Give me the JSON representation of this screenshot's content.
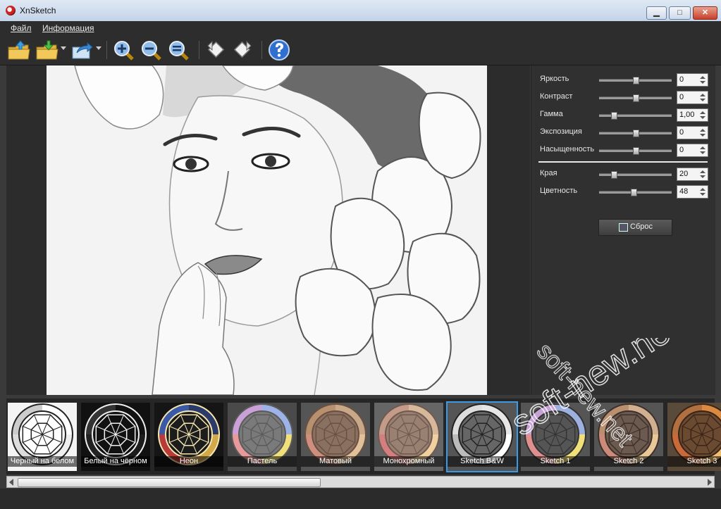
{
  "window": {
    "title": "XnSketch",
    "min_glyph": "▁",
    "max_glyph": "□",
    "close_glyph": "✕"
  },
  "menu": [
    {
      "label": "Файл"
    },
    {
      "label": "Информация"
    }
  ],
  "toolbar": {
    "buttons": [
      {
        "icon": "open-folder-icon"
      },
      {
        "icon": "save-folder-icon"
      },
      {
        "icon": "export-icon"
      },
      {
        "icon": "zoom-in-icon"
      },
      {
        "icon": "zoom-out-icon"
      },
      {
        "icon": "zoom-fit-icon"
      },
      {
        "icon": "rotate-left-icon"
      },
      {
        "icon": "rotate-right-icon"
      },
      {
        "icon": "help-icon"
      }
    ]
  },
  "adjustments": [
    {
      "label": "Яркость",
      "value": "0",
      "level": 0.5
    },
    {
      "label": "Контраст",
      "value": "0",
      "level": 0.5
    },
    {
      "label": "Гамма",
      "value": "1,00",
      "level": 0.2
    },
    {
      "label": "Экспозиция",
      "value": "0",
      "level": 0.5
    },
    {
      "label": "Насыщенность",
      "value": "0",
      "level": 0.5
    }
  ],
  "effects": [
    {
      "label": "Края",
      "value": "20",
      "level": 0.2
    },
    {
      "label": "Цветность",
      "value": "48",
      "level": 0.48
    }
  ],
  "reset_label": "Сброс",
  "presets": [
    {
      "label": "Черный на белом",
      "bg": "#f4f4f4",
      "ring": [
        "#ffffff",
        "#eeeeee",
        "#dddddd",
        "#cccccc"
      ],
      "line": "#222222",
      "inner": "#ffffff"
    },
    {
      "label": "Белый на чёрном",
      "bg": "#111111",
      "ring": [
        "#111111",
        "#1c1c1c",
        "#222222",
        "#333333"
      ],
      "line": "#f0f0f0",
      "inner": "#111111"
    },
    {
      "label": "Неон",
      "bg": "#151515",
      "ring": [
        "#2a3a6a",
        "#d2a94a",
        "#b83a3a",
        "#3a5aa8"
      ],
      "line": "#f6e7b0",
      "inner": "#1c1c1c"
    },
    {
      "label": "Пастель",
      "bg": "#4a4a4a",
      "ring": [
        "#9db2e6",
        "#f0e07a",
        "#e89a9a",
        "#c9a0d8"
      ],
      "line": "#5a5a5a",
      "inner": "#7a7a7a"
    },
    {
      "label": "Матовый",
      "bg": "#555555",
      "ring": [
        "#c9a88a",
        "#e2c09a",
        "#cf8f7f",
        "#b79070"
      ],
      "line": "#6a5040",
      "inner": "#8a7060"
    },
    {
      "label": "Монохромный",
      "bg": "#666666",
      "ring": [
        "#d8b89a",
        "#f0d0a0",
        "#d47f7f",
        "#c49a88"
      ],
      "line": "#6e5a50",
      "inner": "#9a8070"
    },
    {
      "label": "Sketch B&W",
      "bg": "#555555",
      "ring": [
        "#e6e6e6",
        "#ffffff",
        "#bbbbbb",
        "#dddddd"
      ],
      "line": "#222222",
      "inner": "#666666"
    },
    {
      "label": "Sketch 1",
      "bg": "#555555",
      "ring": [
        "#9db0e0",
        "#f1e07a",
        "#e08f8f",
        "#c7a2d6"
      ],
      "line": "#333333",
      "inner": "#555555"
    },
    {
      "label": "Sketch 2",
      "bg": "#555555",
      "ring": [
        "#d0b090",
        "#e9c798",
        "#cc8a7a",
        "#b88f6f"
      ],
      "line": "#3e2f28",
      "inner": "#6a5a50"
    },
    {
      "label": "Sketch 3",
      "bg": "#5a4a3a",
      "ring": [
        "#d98a40",
        "#f0c070",
        "#c86a3a",
        "#b07040"
      ],
      "line": "#3a2418",
      "inner": "#6a4a30"
    }
  ],
  "watermark": {
    "line1": "soft-new.net",
    "line2": "soft-new.net"
  }
}
